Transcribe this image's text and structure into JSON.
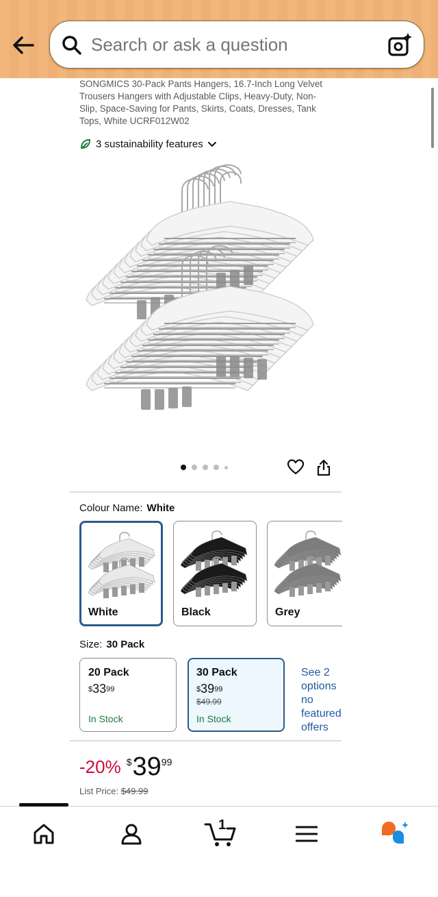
{
  "search": {
    "placeholder": "Search or ask a question"
  },
  "product": {
    "title": "SONGMICS 30-Pack Pants Hangers, 16.7-Inch Long Velvet Trousers Hangers with Adjustable Clips, Heavy-Duty, Non-Slip, Space-Saving for Pants, Skirts, Coats, Dresses, Tank Tops, White UCRF012W02",
    "sustainability": "3 sustainability features"
  },
  "carousel": {
    "total": 5,
    "active": 1
  },
  "colour": {
    "label": "Colour Name:",
    "selected": "White",
    "options": [
      {
        "label": "White",
        "color": "#e9e9e9"
      },
      {
        "label": "Black",
        "color": "#1a1a1a"
      },
      {
        "label": "Grey",
        "color": "#7d7d7d"
      }
    ]
  },
  "size": {
    "label": "Size:",
    "selected": "30 Pack",
    "options": [
      {
        "name": "20 Pack",
        "dollars": "33",
        "cents": "99",
        "strike": "",
        "stock": "In Stock"
      },
      {
        "name": "30 Pack",
        "dollars": "39",
        "cents": "99",
        "strike": "$49.99",
        "stock": "In Stock"
      }
    ],
    "more": "See 2 options no featured offers"
  },
  "price": {
    "discount": "-20%",
    "symbol": "$",
    "dollars": "39",
    "cents": "99",
    "list_label": "List Price:",
    "list_value": "$49.99"
  },
  "nav": {
    "cart_count": "1"
  },
  "colors": {
    "accent": "#2a5a8a",
    "discount": "#cc0c39",
    "link": "#1f5aa0",
    "stock": "#1b7a3a",
    "header": "#f1b77a",
    "ai_orange": "#f26b21",
    "ai_blue": "#1a8fe0"
  }
}
